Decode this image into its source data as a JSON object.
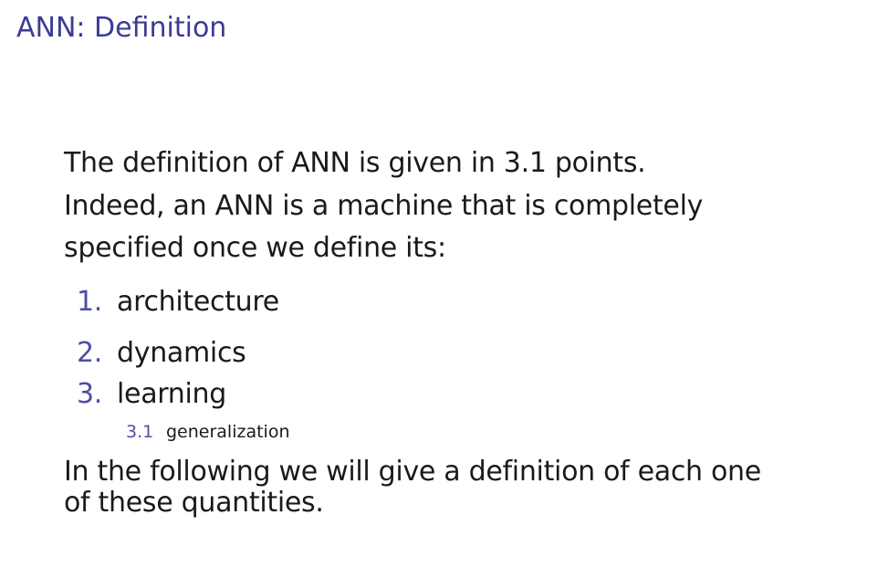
{
  "slide": {
    "title": "ANN: Definition",
    "intro_lines": [
      "The definition of ANN is given in 3.1 points.",
      "Indeed, an ANN is a machine that is completely",
      "specified once we define its:"
    ],
    "items": [
      {
        "number": "1.",
        "label": "architecture"
      },
      {
        "number": "2.",
        "label": "dynamics"
      },
      {
        "number": "3.",
        "label": "learning"
      }
    ],
    "subitem": {
      "number": "3.1",
      "label": "generalization"
    },
    "closing_lines": [
      "In the following we will give a definition of each one",
      "of these quantities."
    ],
    "colors": {
      "title": "#3b3b9a",
      "enumeration": "#4d4da8",
      "text": "#1a1a1a"
    }
  }
}
